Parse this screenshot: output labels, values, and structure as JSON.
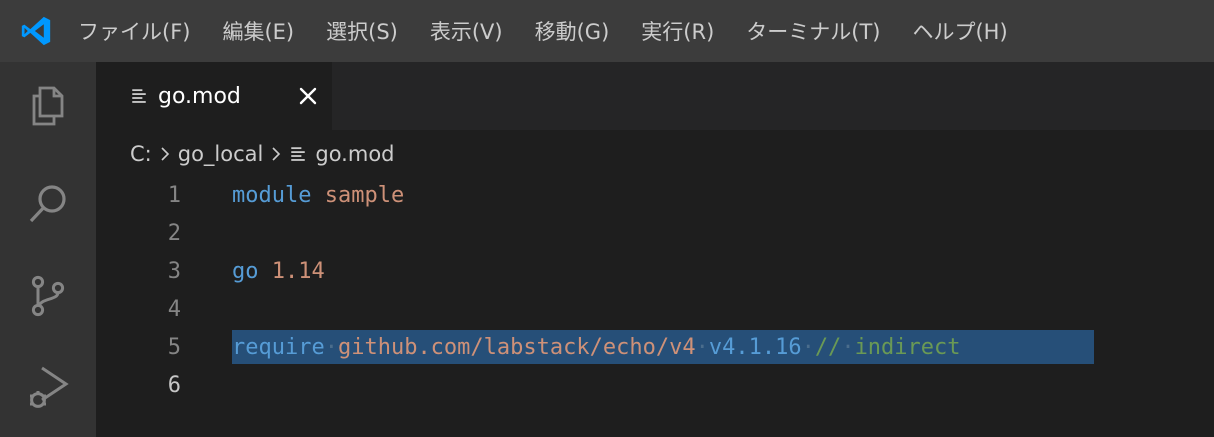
{
  "menubar": {
    "items": [
      {
        "label": "ファイル(F)"
      },
      {
        "label": "編集(E)"
      },
      {
        "label": "選択(S)"
      },
      {
        "label": "表示(V)"
      },
      {
        "label": "移動(G)"
      },
      {
        "label": "実行(R)"
      },
      {
        "label": "ターミナル(T)"
      },
      {
        "label": "ヘルプ(H)"
      }
    ]
  },
  "activity_bar": {
    "icons": [
      "files-icon",
      "search-icon",
      "source-control-icon",
      "run-debug-icon"
    ]
  },
  "tab": {
    "label": "go.mod",
    "icon": "file-lines-icon",
    "close_icon": "close-icon"
  },
  "breadcrumb": {
    "items": [
      "C:",
      "go_local",
      "go.mod"
    ]
  },
  "editor": {
    "lines": [
      {
        "number": "1",
        "tokens": [
          {
            "t": "module",
            "c": "kw"
          },
          {
            "t": " ",
            "c": ""
          },
          {
            "t": "sample",
            "c": "str"
          }
        ]
      },
      {
        "number": "2",
        "tokens": []
      },
      {
        "number": "3",
        "tokens": [
          {
            "t": "go",
            "c": "kw"
          },
          {
            "t": " ",
            "c": ""
          },
          {
            "t": "1.14",
            "c": "str"
          }
        ]
      },
      {
        "number": "4",
        "tokens": []
      },
      {
        "number": "5",
        "selected": true,
        "tokens": [
          {
            "t": "require",
            "c": "kw"
          },
          {
            "t": "·",
            "c": "ws"
          },
          {
            "t": "github.com/labstack/echo/v4",
            "c": "str"
          },
          {
            "t": "·",
            "c": "ws"
          },
          {
            "t": "v4.1.16",
            "c": "kw"
          },
          {
            "t": "·",
            "c": "ws"
          },
          {
            "t": "//",
            "c": "cmt"
          },
          {
            "t": "·",
            "c": "ws"
          },
          {
            "t": "indirect",
            "c": "cmt"
          }
        ]
      },
      {
        "number": "6",
        "active": true,
        "tokens": []
      }
    ]
  },
  "colors": {
    "keyword": "#569cd6",
    "string": "#ce9178",
    "comment": "#6a9955",
    "selection": "#264f78",
    "accent": "#0098ff"
  }
}
